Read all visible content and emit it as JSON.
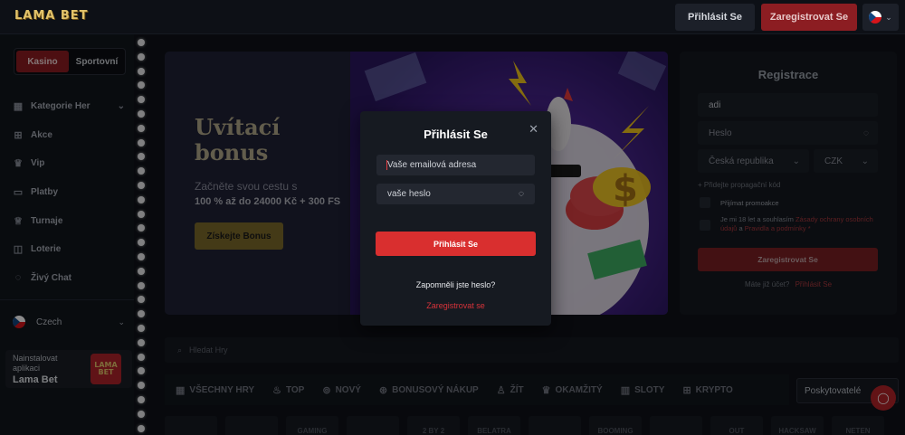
{
  "header": {
    "logo": "LAMA BET",
    "login_label": "Přihlásit Se",
    "register_label": "Zaregistrovat Se"
  },
  "sidebar": {
    "modes": [
      "Kasino",
      "Sportovní"
    ],
    "active_mode": "Kasino",
    "items": [
      {
        "label": "Kategorie Her",
        "icon": "games-icon"
      },
      {
        "label": "Akce",
        "icon": "gift-icon"
      },
      {
        "label": "Vip",
        "icon": "crown-icon"
      },
      {
        "label": "Platby",
        "icon": "card-icon"
      },
      {
        "label": "Turnaje",
        "icon": "trophy-icon"
      },
      {
        "label": "Loterie",
        "icon": "ticket-icon"
      },
      {
        "label": "Živý Chat",
        "icon": "chat-icon"
      }
    ],
    "language": "Czech",
    "install": {
      "line1": "Nainstalovat aplikaci",
      "line2": "Lama Bet",
      "logo": "LAMA BET"
    }
  },
  "banner": {
    "title": "Uvítací bonus",
    "subtitle": "Začněte svou cestu s",
    "offer": "100 % až do 24000 Kč + 300 FS",
    "cta": "Získejte Bonus"
  },
  "registration": {
    "title": "Registrace",
    "username_value": "adi",
    "password_placeholder": "Heslo",
    "country": "Česká republika",
    "currency": "CZK",
    "promo_link": "+ Přidejte propagační kód",
    "accept_promo": "Přijímat promoakce",
    "age_text_1": "Je mi 18 let a souhlasím",
    "privacy_link": "Zásady ochrany osobních údajů",
    "and_text": "a",
    "terms_link": "Pravidla a podmínky",
    "terms_suffix": "*",
    "submit": "Zaregistrovat Se",
    "have_account": "Máte již účet?",
    "login_link": "Přihlásit Se"
  },
  "search": {
    "placeholder": "Hledat Hry"
  },
  "categories": [
    {
      "label": "VŠECHNY HRY",
      "icon": "grid-icon"
    },
    {
      "label": "TOP",
      "icon": "flame-icon"
    },
    {
      "label": "NOVÝ",
      "icon": "new-icon"
    },
    {
      "label": "BONUSOVÝ NÁKUP",
      "icon": "bonus-icon"
    },
    {
      "label": "ŽÍT",
      "icon": "live-icon"
    },
    {
      "label": "OKAMŽITÝ",
      "icon": "instant-icon"
    },
    {
      "label": "SLOTY",
      "icon": "slots-icon"
    },
    {
      "label": "KRYPTO",
      "icon": "crypto-icon"
    }
  ],
  "providers_label": "Poskytovatelé",
  "provider_logos": [
    "",
    "",
    "GAMING",
    "",
    "2 BY 2",
    "BELATRA",
    "",
    "BOOMING",
    "",
    "OUT",
    "HACKSAW",
    "NETEN"
  ],
  "modal": {
    "title": "Přihlásit Se",
    "email_placeholder": "Vaše emailová adresa",
    "password_placeholder": "vaše heslo",
    "submit": "Přihlásit Se",
    "forgot": "Zapomněli jste heslo?",
    "register": "Zaregistrovat se"
  }
}
